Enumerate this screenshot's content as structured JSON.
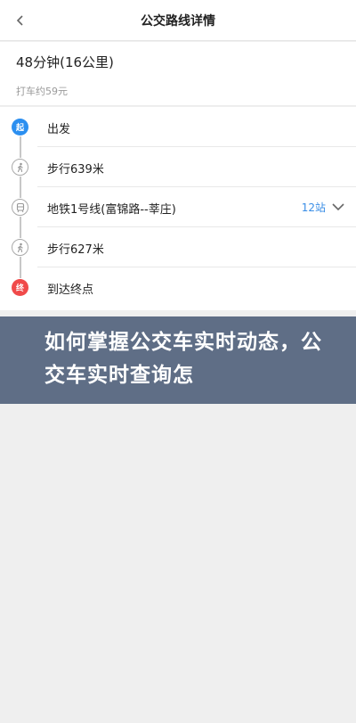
{
  "header": {
    "title": "公交路线详情",
    "back_icon": "chevron-left-icon"
  },
  "summary": {
    "duration": "48分钟(16公里)",
    "taxi": "打车约59元"
  },
  "route": {
    "steps": [
      {
        "label": "出发",
        "marker": "起",
        "type": "start"
      },
      {
        "label": "步行639米",
        "icon": "walk-icon",
        "type": "walk"
      },
      {
        "label": "地铁1号线(富锦路--莘庄)",
        "icon": "subway-icon",
        "type": "subway",
        "stops": "12站"
      },
      {
        "label": "步行627米",
        "icon": "walk-icon",
        "type": "walk"
      },
      {
        "label": "到达终点",
        "marker": "终",
        "type": "end"
      }
    ]
  },
  "banner": {
    "text": "如何掌握公交车实时动态，公交车实时查询怎"
  },
  "colors": {
    "accent": "#3a8ee6",
    "start": "#2b8ff0",
    "end": "#f04a4a",
    "banner": "#5f6e86"
  }
}
